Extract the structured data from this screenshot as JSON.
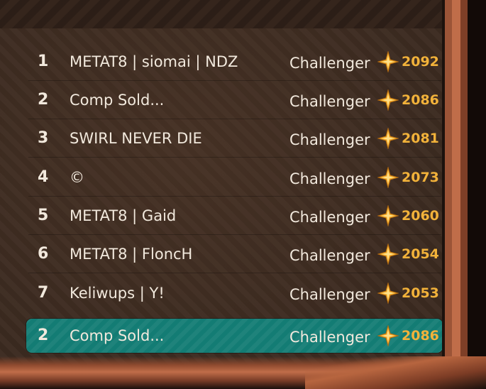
{
  "leaderboard": {
    "rows": [
      {
        "rank": "1",
        "name": "METAT8 | siomai | NDZ",
        "tier": "Challenger",
        "score": "2092"
      },
      {
        "rank": "2",
        "name": "Comp Sold...",
        "tier": "Challenger",
        "score": "2086"
      },
      {
        "rank": "3",
        "name": "SWIRL NEVER DIE",
        "tier": "Challenger",
        "score": "2081"
      },
      {
        "rank": "4",
        "name": "©",
        "tier": "Challenger",
        "score": "2073"
      },
      {
        "rank": "5",
        "name": "METAT8 | Gaid",
        "tier": "Challenger",
        "score": "2060"
      },
      {
        "rank": "6",
        "name": "METAT8 | FloncH",
        "tier": "Challenger",
        "score": "2054"
      },
      {
        "rank": "7",
        "name": "Keliwups | Y!",
        "tier": "Challenger",
        "score": "2053"
      }
    ],
    "current_player": {
      "rank": "2",
      "name": "Comp Sold...",
      "tier": "Challenger",
      "score": "2086"
    }
  },
  "icons": {
    "rank_icon": "star-icon"
  },
  "colors": {
    "highlight": "#137c74",
    "score": "#f2b23a",
    "text": "#f2e9dd",
    "board": "#3b2a20"
  }
}
